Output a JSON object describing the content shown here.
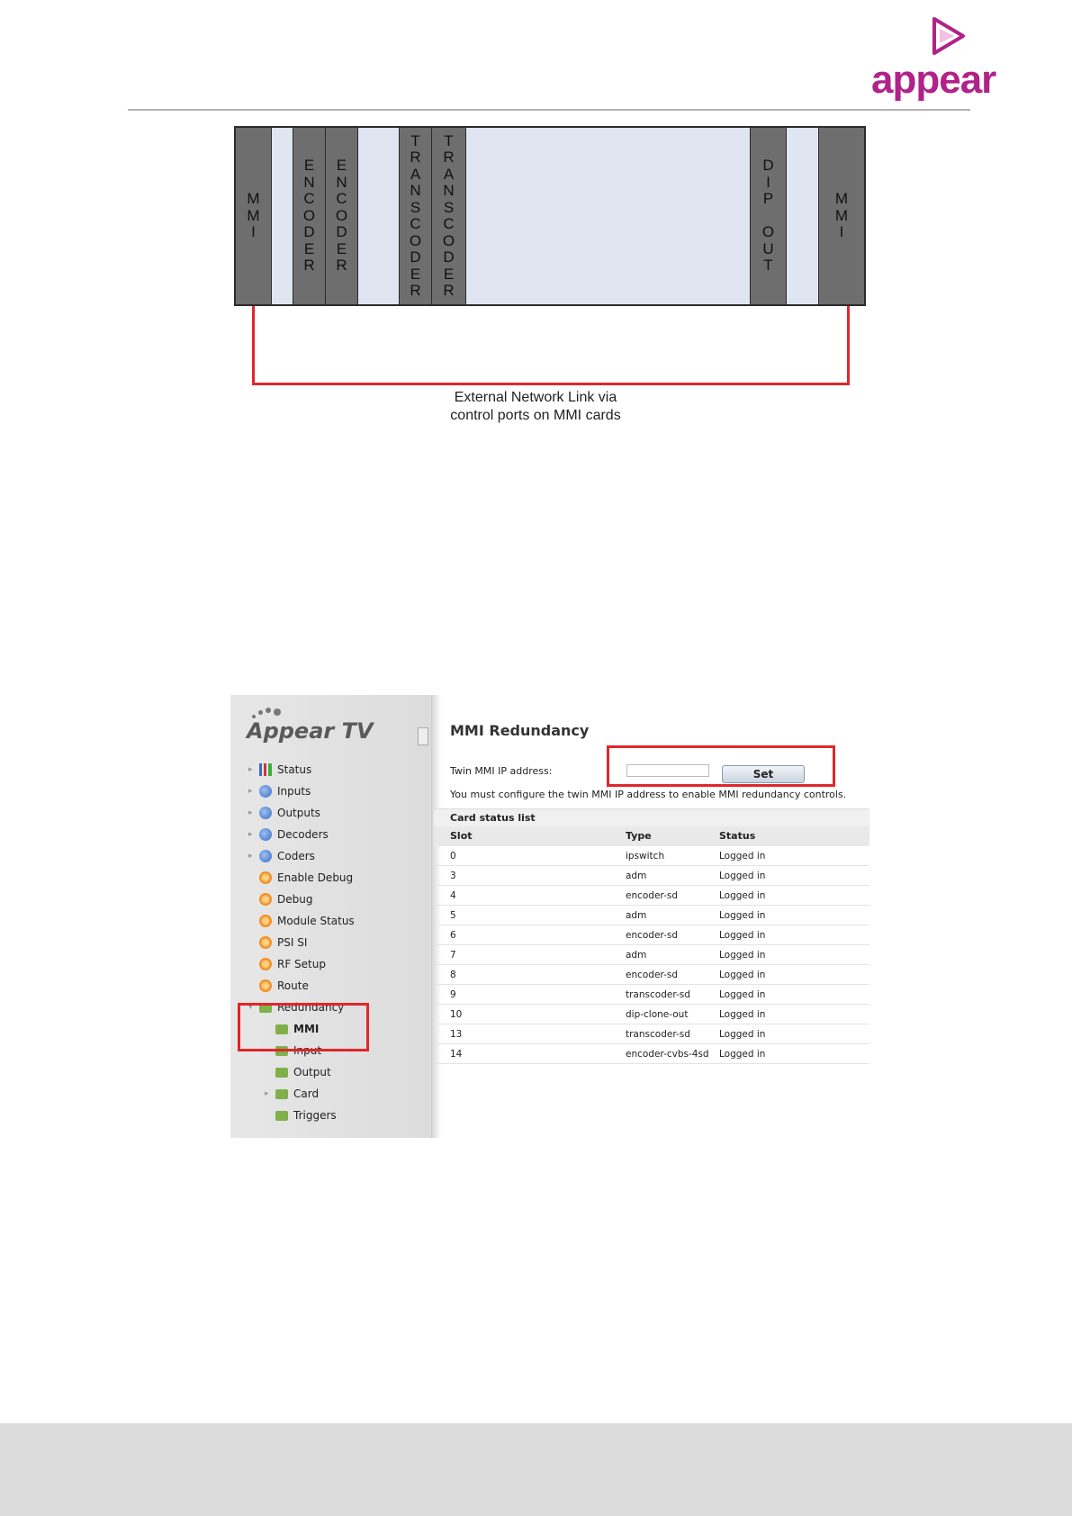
{
  "brand": {
    "logo_text": "appear",
    "accent": "#b0228a"
  },
  "diagram": {
    "slots": [
      {
        "label": "MMI",
        "dark": true
      },
      {
        "label": "",
        "dark": false
      },
      {
        "label": "ENCODER",
        "dark": true
      },
      {
        "label": "ENCODER",
        "dark": true
      },
      {
        "label": "",
        "dark": false
      },
      {
        "label": "TRANSCODER",
        "dark": true
      },
      {
        "label": "TRANSCODER",
        "dark": true
      },
      {
        "label": "",
        "dark": false
      },
      {
        "label": "DIP OUT",
        "dark": true
      },
      {
        "label": "",
        "dark": false
      },
      {
        "label": "MMI",
        "dark": true
      }
    ],
    "link_caption_line1": "External Network Link via",
    "link_caption_line2": "control ports on MMI cards",
    "link_color": "#e0262b"
  },
  "app": {
    "brand": "Appear TV",
    "nav": [
      {
        "label": "Status",
        "icon": "chart-icon",
        "expandable": true
      },
      {
        "label": "Inputs",
        "icon": "globe-icon",
        "expandable": true
      },
      {
        "label": "Outputs",
        "icon": "globe-icon",
        "expandable": true
      },
      {
        "label": "Decoders",
        "icon": "globe-icon",
        "expandable": true
      },
      {
        "label": "Coders",
        "icon": "globe-icon",
        "expandable": true
      },
      {
        "label": "Enable Debug",
        "icon": "gear-icon",
        "expandable": false
      },
      {
        "label": "Debug",
        "icon": "gear-icon",
        "expandable": false
      },
      {
        "label": "Module Status",
        "icon": "gear-icon",
        "expandable": false
      },
      {
        "label": "PSI SI",
        "icon": "gear-icon",
        "expandable": false
      },
      {
        "label": "RF Setup",
        "icon": "gear-icon",
        "expandable": false
      },
      {
        "label": "Route",
        "icon": "gear-icon",
        "expandable": false
      },
      {
        "label": "Redundancy",
        "icon": "folder-icon",
        "expandable": true,
        "expanded": true
      },
      {
        "label": "MMI",
        "icon": "folder-icon",
        "child": true,
        "selected": true
      },
      {
        "label": "Input",
        "icon": "folder-icon",
        "child": true
      },
      {
        "label": "Output",
        "icon": "folder-icon",
        "child": true
      },
      {
        "label": "Card",
        "icon": "folder-icon",
        "child": true,
        "expandable": true
      },
      {
        "label": "Triggers",
        "icon": "folder-icon",
        "child": true
      }
    ],
    "page_title": "MMI Redundancy",
    "twin_ip_label": "Twin MMI IP address:",
    "twin_ip_value": "",
    "set_button": "Set",
    "warning": "You must configure the twin MMI IP address to enable MMI redundancy controls.",
    "card_list_title": "Card status list",
    "columns": [
      "Slot",
      "Type",
      "Status"
    ],
    "rows": [
      [
        "0",
        "ipswitch",
        "Logged in"
      ],
      [
        "3",
        "adm",
        "Logged in"
      ],
      [
        "4",
        "encoder-sd",
        "Logged in"
      ],
      [
        "5",
        "adm",
        "Logged in"
      ],
      [
        "6",
        "encoder-sd",
        "Logged in"
      ],
      [
        "7",
        "adm",
        "Logged in"
      ],
      [
        "8",
        "encoder-sd",
        "Logged in"
      ],
      [
        "9",
        "transcoder-sd",
        "Logged in"
      ],
      [
        "10",
        "dip-clone-out",
        "Logged in"
      ],
      [
        "13",
        "transcoder-sd",
        "Logged in"
      ],
      [
        "14",
        "encoder-cvbs-4sd",
        "Logged in"
      ]
    ],
    "highlight_color": "#e0262b"
  }
}
